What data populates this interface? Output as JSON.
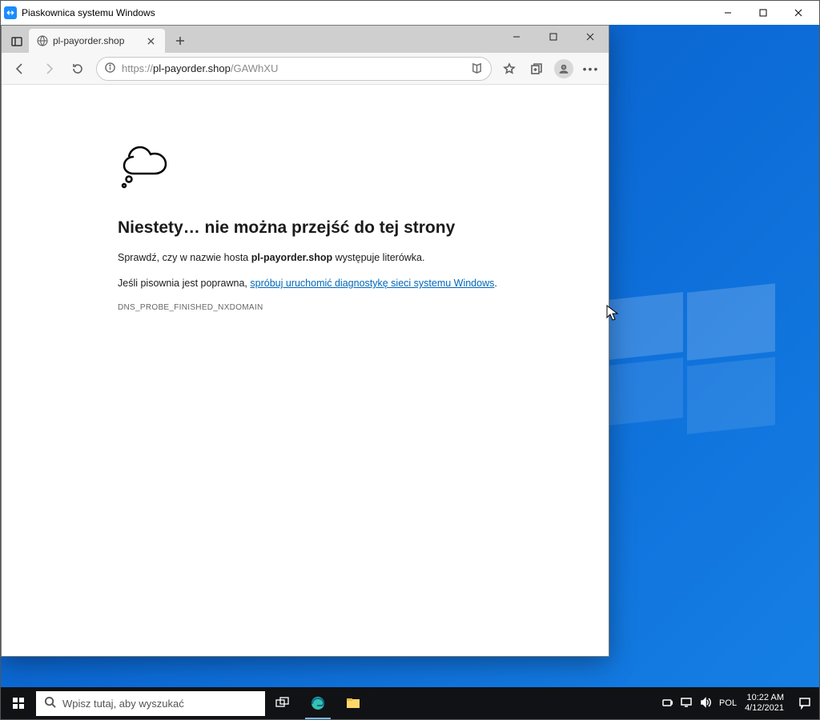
{
  "outer": {
    "title": "Piaskownica systemu Windows"
  },
  "browser": {
    "tab_title": "pl-payorder.shop",
    "url_scheme": "https://",
    "url_host": "pl-payorder.shop",
    "url_path": "/GAWhXU"
  },
  "page": {
    "heading": "Niestety… nie można przejść do tej strony",
    "check_prefix": "Sprawdź, czy w nazwie hosta ",
    "check_host": "pl-payorder.shop",
    "check_suffix": " występuje literówka.",
    "spelling_prefix": "Jeśli pisownia jest poprawna, ",
    "diag_link": "spróbuj uruchomić diagnostykę sieci systemu Windows",
    "error_code": "DNS_PROBE_FINISHED_NXDOMAIN"
  },
  "taskbar": {
    "search_placeholder": "Wpisz tutaj, aby wyszukać",
    "lang": "POL",
    "time": "10:22 AM",
    "date": "4/12/2021"
  }
}
